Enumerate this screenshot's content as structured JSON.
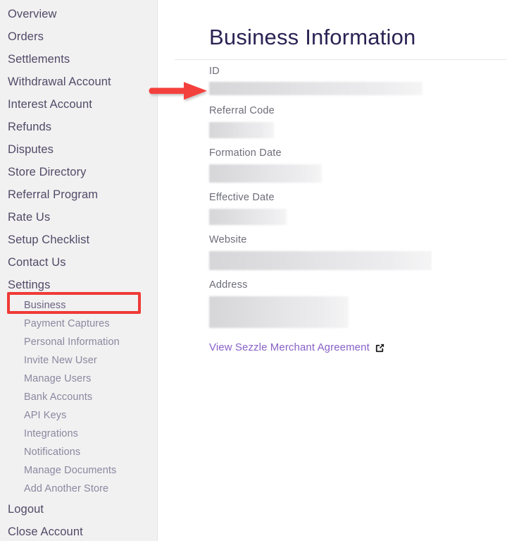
{
  "sidebar": {
    "items": [
      {
        "label": "Overview"
      },
      {
        "label": "Orders"
      },
      {
        "label": "Settlements"
      },
      {
        "label": "Withdrawal Account"
      },
      {
        "label": "Interest Account"
      },
      {
        "label": "Refunds"
      },
      {
        "label": "Disputes"
      },
      {
        "label": "Store Directory"
      },
      {
        "label": "Referral Program"
      },
      {
        "label": "Rate Us"
      },
      {
        "label": "Setup Checklist"
      },
      {
        "label": "Contact Us"
      },
      {
        "label": "Settings"
      }
    ],
    "settings_children": [
      {
        "label": "Business",
        "active": true
      },
      {
        "label": "Payment Captures",
        "active": false
      },
      {
        "label": "Personal Information",
        "active": false
      },
      {
        "label": "Invite New User",
        "active": false
      },
      {
        "label": "Manage Users",
        "active": false
      },
      {
        "label": "Bank Accounts",
        "active": false
      },
      {
        "label": "API Keys",
        "active": false
      },
      {
        "label": "Integrations",
        "active": false
      },
      {
        "label": "Notifications",
        "active": false
      },
      {
        "label": "Manage Documents",
        "active": false
      },
      {
        "label": "Add Another Store",
        "active": false
      }
    ],
    "footer_items": [
      {
        "label": "Logout"
      },
      {
        "label": "Close Account"
      }
    ]
  },
  "main": {
    "title": "Business Information",
    "fields": [
      {
        "label": "ID",
        "value": ""
      },
      {
        "label": "Referral Code",
        "value": ""
      },
      {
        "label": "Formation Date",
        "value": ""
      },
      {
        "label": "Effective Date",
        "value": ""
      },
      {
        "label": "Website",
        "value": ""
      },
      {
        "label": "Address",
        "value": ""
      }
    ],
    "agreement_link": {
      "label": "View Sezzle Merchant Agreement",
      "icon": "external-link-icon"
    }
  },
  "annotations": {
    "arrow": {
      "icon": "red-arrow-right",
      "target": "ID"
    },
    "highlight_box": {
      "target": "Business"
    }
  },
  "colors": {
    "sidebar_bg": "#f1f1f1",
    "nav_text": "#524a68",
    "subnav_text": "#8c87a0",
    "title": "#2b2354",
    "label": "#6d6d7a",
    "link": "#8861c8",
    "annotation_red": "#ef3b36",
    "redacted_bar": "#dcdcde"
  }
}
